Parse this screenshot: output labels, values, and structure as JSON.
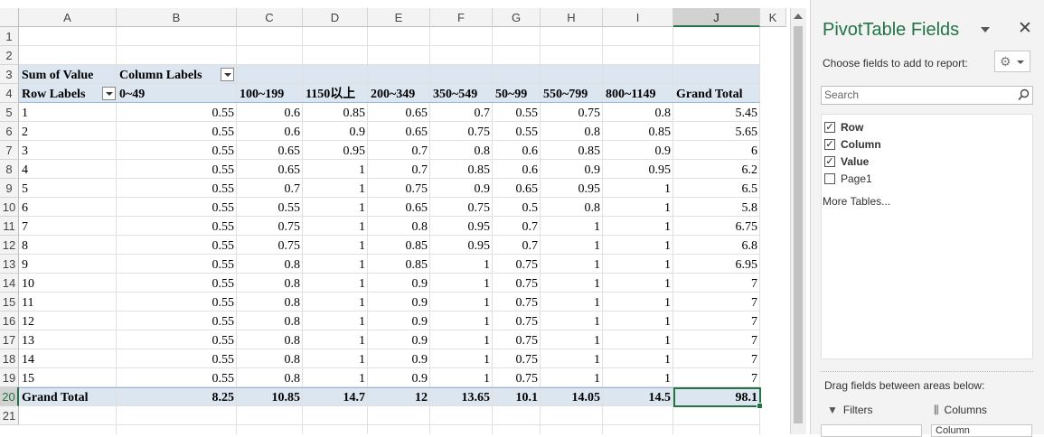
{
  "sheet": {
    "columns": [
      "A",
      "B",
      "C",
      "D",
      "E",
      "F",
      "G",
      "H",
      "I",
      "J",
      "K"
    ],
    "rows": [
      "1",
      "2",
      "3",
      "4",
      "5",
      "6",
      "7",
      "8",
      "9",
      "10",
      "11",
      "12",
      "13",
      "14",
      "15",
      "16",
      "17",
      "18",
      "19",
      "20",
      "21"
    ],
    "pivot": {
      "sum_label": "Sum of Value",
      "column_labels": "Column Labels",
      "row_labels": "Row Labels",
      "headers": [
        "0~49",
        "100~199",
        "1150以上",
        "200~349",
        "350~549",
        "50~99",
        "550~799",
        "800~1149",
        "Grand Total"
      ],
      "data": [
        [
          "1",
          "0.55",
          "0.6",
          "0.85",
          "0.65",
          "0.7",
          "0.55",
          "0.75",
          "0.8",
          "5.45"
        ],
        [
          "2",
          "0.55",
          "0.6",
          "0.9",
          "0.65",
          "0.75",
          "0.55",
          "0.8",
          "0.85",
          "5.65"
        ],
        [
          "3",
          "0.55",
          "0.65",
          "0.95",
          "0.7",
          "0.8",
          "0.6",
          "0.85",
          "0.9",
          "6"
        ],
        [
          "4",
          "0.55",
          "0.65",
          "1",
          "0.7",
          "0.85",
          "0.6",
          "0.9",
          "0.95",
          "6.2"
        ],
        [
          "5",
          "0.55",
          "0.7",
          "1",
          "0.75",
          "0.9",
          "0.65",
          "0.95",
          "1",
          "6.5"
        ],
        [
          "6",
          "0.55",
          "0.55",
          "1",
          "0.65",
          "0.75",
          "0.5",
          "0.8",
          "1",
          "5.8"
        ],
        [
          "7",
          "0.55",
          "0.75",
          "1",
          "0.8",
          "0.95",
          "0.7",
          "1",
          "1",
          "6.75"
        ],
        [
          "8",
          "0.55",
          "0.75",
          "1",
          "0.85",
          "0.95",
          "0.7",
          "1",
          "1",
          "6.8"
        ],
        [
          "9",
          "0.55",
          "0.8",
          "1",
          "0.85",
          "1",
          "0.75",
          "1",
          "1",
          "6.95"
        ],
        [
          "10",
          "0.55",
          "0.8",
          "1",
          "0.9",
          "1",
          "0.75",
          "1",
          "1",
          "7"
        ],
        [
          "11",
          "0.55",
          "0.8",
          "1",
          "0.9",
          "1",
          "0.75",
          "1",
          "1",
          "7"
        ],
        [
          "12",
          "0.55",
          "0.8",
          "1",
          "0.9",
          "1",
          "0.75",
          "1",
          "1",
          "7"
        ],
        [
          "13",
          "0.55",
          "0.8",
          "1",
          "0.9",
          "1",
          "0.75",
          "1",
          "1",
          "7"
        ],
        [
          "14",
          "0.55",
          "0.8",
          "1",
          "0.9",
          "1",
          "0.75",
          "1",
          "1",
          "7"
        ],
        [
          "15",
          "0.55",
          "0.8",
          "1",
          "0.9",
          "1",
          "0.75",
          "1",
          "1",
          "7"
        ]
      ],
      "grand_total_label": "Grand Total",
      "grand_totals": [
        "8.25",
        "10.85",
        "14.7",
        "12",
        "13.65",
        "10.1",
        "14.05",
        "14.5",
        "98.1"
      ]
    },
    "colors": {
      "band": "#dce6f1",
      "selection": "#217346",
      "header_bg": "#f3f3f3"
    }
  },
  "pane": {
    "title": "PivotTable Fields",
    "subtitle": "Choose fields to add to report:",
    "search_placeholder": "Search",
    "fields": [
      {
        "label": "Row",
        "checked": true
      },
      {
        "label": "Column",
        "checked": true
      },
      {
        "label": "Value",
        "checked": true
      },
      {
        "label": "Page1",
        "checked": false
      }
    ],
    "more_tables": "More Tables...",
    "drag_text": "Drag fields between areas below:",
    "areas": {
      "filters": "Filters",
      "columns": "Columns",
      "columns_value": "Column"
    },
    "icons": [
      "chevron-down-icon",
      "close-icon",
      "gear-icon",
      "search-icon",
      "filter-icon",
      "columns-icon"
    ]
  }
}
